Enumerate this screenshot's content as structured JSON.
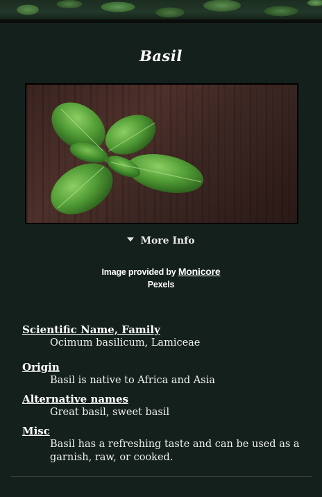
{
  "page": {
    "title": "Basil",
    "more_info_label": "More Info",
    "credit": {
      "prefix": "Image provided by",
      "author": "Monicore",
      "source": "Pexels"
    },
    "sections": [
      {
        "heading": "Scientific Name, Family",
        "value": "Ocimum basilicum, Lamiceae"
      },
      {
        "heading": "Origin",
        "value": "Basil is native to Africa and Asia"
      },
      {
        "heading": "Alternative names",
        "value": "Great basil, sweet basil"
      },
      {
        "heading": "Misc",
        "value": "Basil has a refreshing taste and can be used as a garnish, raw, or cooked."
      }
    ]
  },
  "colors": {
    "background": "#14201c",
    "text": "#ffffff"
  }
}
